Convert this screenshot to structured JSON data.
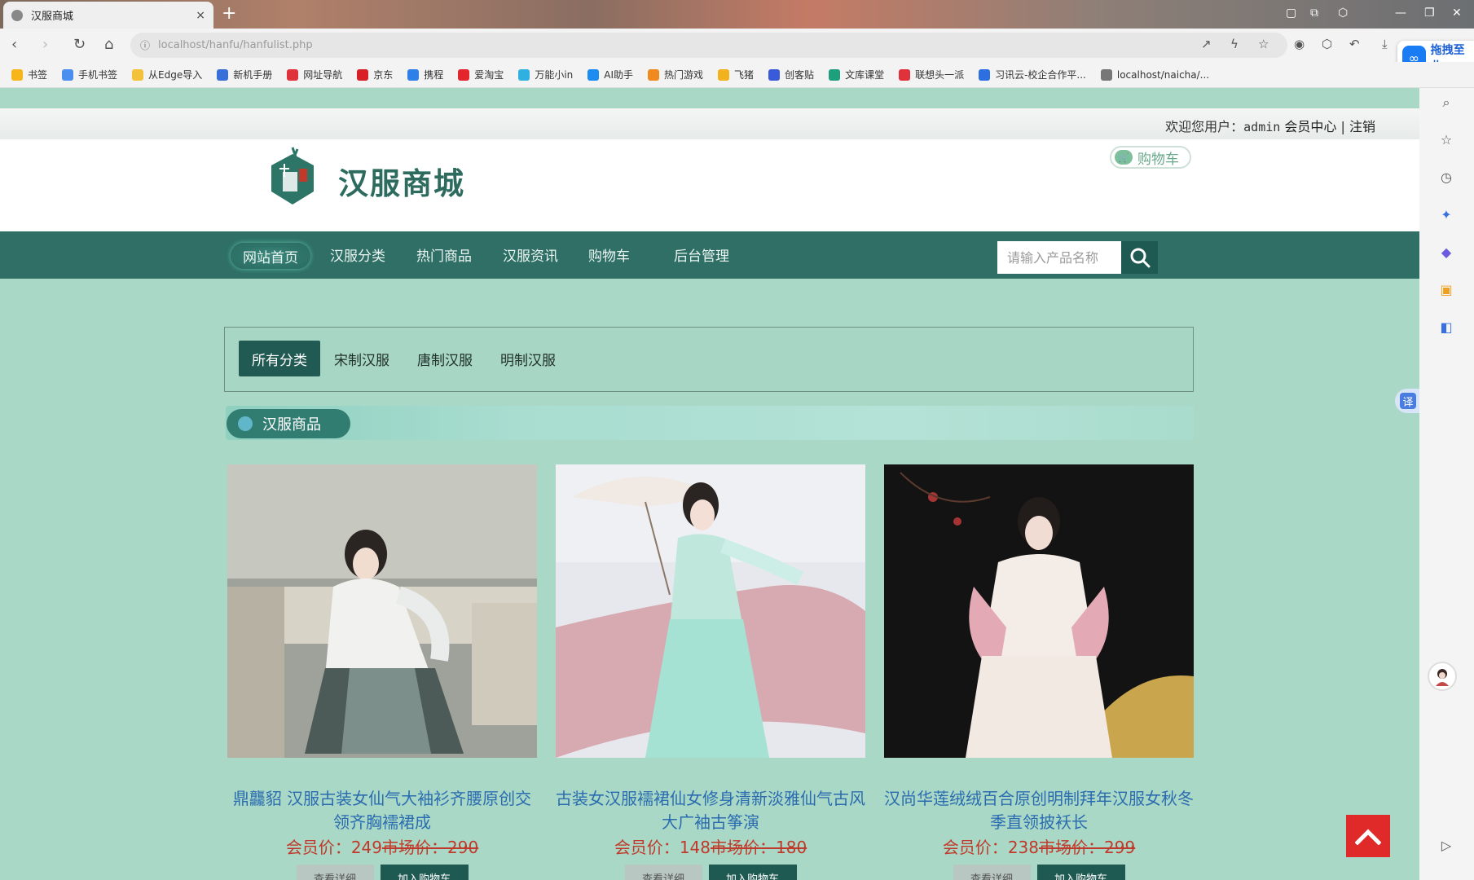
{
  "browser": {
    "tab_title": "汉服商城",
    "tab_close": "×",
    "new_tab": "+",
    "url": "localhost/hanfu/hanfulist.php",
    "baidu_label": "拖拽至此",
    "bookmarks": [
      {
        "label": "书签",
        "color": "#f5b51b"
      },
      {
        "label": "手机书签",
        "color": "#4a8ef0"
      },
      {
        "label": "从Edge导入",
        "color": "#f2c23d"
      },
      {
        "label": "新机手册",
        "color": "#3b6fd8"
      },
      {
        "label": "网址导航",
        "color": "#e0323a"
      },
      {
        "label": "京东",
        "color": "#d81e26"
      },
      {
        "label": "携程",
        "color": "#2e7fe8"
      },
      {
        "label": "爱淘宝",
        "color": "#e3262b"
      },
      {
        "label": "万能小in",
        "color": "#2fb0e0"
      },
      {
        "label": "AI助手",
        "color": "#1d8cf0"
      },
      {
        "label": "热门游戏",
        "color": "#f08a1e"
      },
      {
        "label": "飞猪",
        "color": "#f2b21e"
      },
      {
        "label": "创客贴",
        "color": "#3a5bd9"
      },
      {
        "label": "文库课堂",
        "color": "#1fa07c"
      },
      {
        "label": "联想头一派",
        "color": "#e0323a"
      },
      {
        "label": "习讯云-校企合作平...",
        "color": "#2d6ee0"
      },
      {
        "label": "localhost/naicha/...",
        "color": "#777777"
      }
    ]
  },
  "userbar": {
    "welcome": "欢迎您用户：",
    "username": "admin",
    "member_center": "会员中心",
    "separator": "|",
    "logout": "注销"
  },
  "header": {
    "site_name": "汉服商城",
    "cart_label": "购物车"
  },
  "nav": {
    "items": [
      "网站首页",
      "汉服分类",
      "热门商品",
      "汉服资讯",
      "购物车",
      "后台管理"
    ],
    "search_placeholder": "请输入产品名称"
  },
  "categories": [
    "所有分类",
    "宋制汉服",
    "唐制汉服",
    "明制汉服"
  ],
  "section_title": "汉服商品",
  "products": [
    {
      "title": "鼎龘貂 汉服古装女仙气大袖衫齐腰原创交领齐胸襦裙成",
      "member_price_label": "会员价：",
      "member_price": "249",
      "market_price": "市场价：290",
      "detail_btn": "查看详细",
      "cart_btn": "加入购物车"
    },
    {
      "title": "古装女汉服襦裙仙女修身清新淡雅仙气古风大广袖古筝演",
      "member_price_label": "会员价：",
      "member_price": "148",
      "market_price": "市场价：180",
      "detail_btn": "查看详细",
      "cart_btn": "加入购物车"
    },
    {
      "title": "汉尚华莲绒绒百合原创明制拜年汉服女秋冬季直领披袄长",
      "member_price_label": "会员价：",
      "member_price": "238",
      "market_price": "市场价：299",
      "detail_btn": "查看详细",
      "cart_btn": "加入购物车"
    }
  ],
  "colors": {
    "page_bg": "#a9d9c6",
    "nav_bg": "#2f6f66",
    "accent_dark": "#1f5a52",
    "title_blue": "#2b6cb0",
    "price_red": "#c0392b",
    "to_top_red": "#e02a2a"
  }
}
